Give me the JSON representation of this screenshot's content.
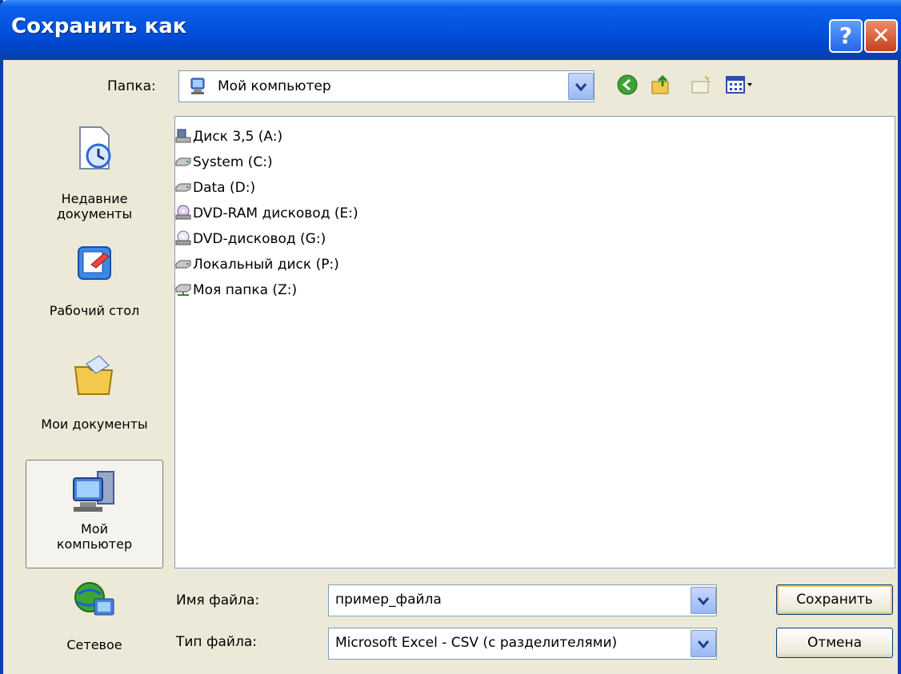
{
  "window": {
    "title": "Сохранить как"
  },
  "folder": {
    "label": "Папка:",
    "value": "Мой компьютер"
  },
  "places": [
    {
      "label_line1": "Недавние",
      "label_line2": "документы"
    },
    {
      "label_line1": "Рабочий стол"
    },
    {
      "label_line1": "Мои документы"
    },
    {
      "label_line1": "Мой",
      "label_line2": "компьютер"
    },
    {
      "label_line1": "Сетевое"
    }
  ],
  "items": [
    {
      "label": "Диск 3,5 (A:)",
      "icon": "floppy-drive-icon"
    },
    {
      "label": "System (C:)",
      "icon": "hard-drive-icon"
    },
    {
      "label": "Data (D:)",
      "icon": "hard-drive-icon"
    },
    {
      "label": "DVD-RAM дисковод (E:)",
      "icon": "dvd-drive-icon"
    },
    {
      "label": "DVD-дисковод (G:)",
      "icon": "dvd-drive-icon"
    },
    {
      "label": "Локальный диск (P:)",
      "icon": "hard-drive-icon"
    },
    {
      "label": "Моя папка (Z:)",
      "icon": "network-drive-icon"
    }
  ],
  "filename": {
    "label": "Имя файла:",
    "value": "пример_файла"
  },
  "filetype": {
    "label": "Тип файла:",
    "value": "Microsoft Excel - CSV (с разделителями)"
  },
  "buttons": {
    "save": "Сохранить",
    "cancel": "Отмена"
  },
  "colors": {
    "titlebar": "#0054e3",
    "dialog_bg": "#ece9d8",
    "border": "#7f9db9"
  }
}
